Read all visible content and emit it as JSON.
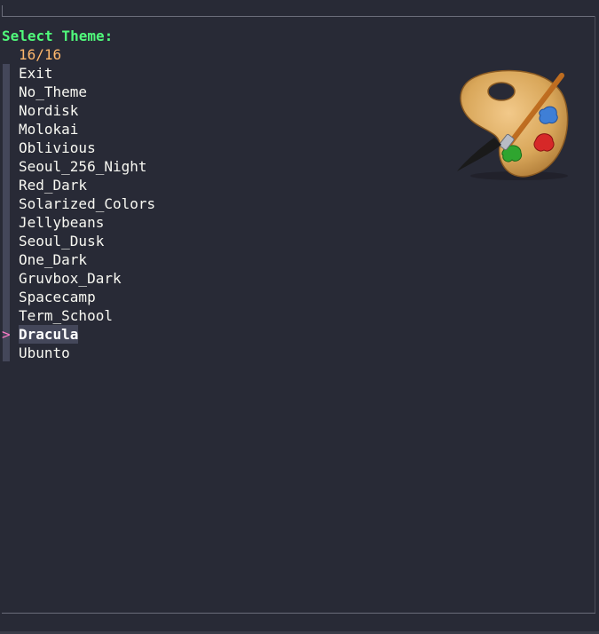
{
  "prompt": "Select Theme:",
  "counter": "16/16",
  "pointer_glyph": ">",
  "items": [
    {
      "label": "Exit",
      "selected": false
    },
    {
      "label": "No_Theme",
      "selected": false
    },
    {
      "label": "Nordisk",
      "selected": false
    },
    {
      "label": "Molokai",
      "selected": false
    },
    {
      "label": "Oblivious",
      "selected": false
    },
    {
      "label": "Seoul_256_Night",
      "selected": false
    },
    {
      "label": "Red_Dark",
      "selected": false
    },
    {
      "label": "Solarized_Colors",
      "selected": false
    },
    {
      "label": "Jellybeans",
      "selected": false
    },
    {
      "label": "Seoul_Dusk",
      "selected": false
    },
    {
      "label": "One_Dark",
      "selected": false
    },
    {
      "label": "Gruvbox_Dark",
      "selected": false
    },
    {
      "label": "Spacecamp",
      "selected": false
    },
    {
      "label": "Term_School",
      "selected": false
    },
    {
      "label": "Dracula",
      "selected": true
    },
    {
      "label": "Ubunto",
      "selected": false
    }
  ],
  "colors": {
    "background": "#282a36",
    "prompt": "#50fa7b",
    "counter": "#ffb86c",
    "pointer": "#ff79c6",
    "selection_bg": "#44475a",
    "text": "#f8f8f2"
  },
  "icon": "paint-palette-icon"
}
